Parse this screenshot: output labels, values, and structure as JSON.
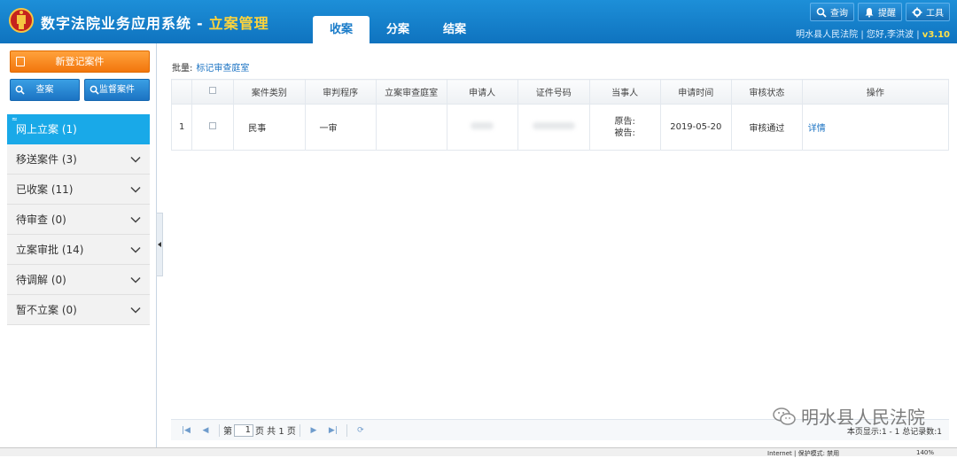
{
  "header": {
    "app_name": "数字法院业务应用系统",
    "separator": "-",
    "module": "立案管理",
    "tabs": [
      {
        "label": "收案",
        "active": true
      },
      {
        "label": "分案",
        "active": false
      },
      {
        "label": "结案",
        "active": false
      }
    ],
    "tools": [
      {
        "label": "查询",
        "icon": "search-icon"
      },
      {
        "label": "提醒",
        "icon": "bell-icon"
      },
      {
        "label": "工具",
        "icon": "gear-icon"
      }
    ],
    "user_info": "明水县人民法院 | 您好,李洪波 |",
    "version": "v3.10"
  },
  "sidebar": {
    "new_case_label": "新登记案件",
    "search_label": "查案",
    "supervise_label": "监督案件",
    "corner_mark": "≈",
    "items": [
      {
        "label": "网上立案 (1)",
        "active": true
      },
      {
        "label": "移送案件 (3)",
        "active": false
      },
      {
        "label": "已收案 (11)",
        "active": false
      },
      {
        "label": "待审查 (0)",
        "active": false
      },
      {
        "label": "立案审批 (14)",
        "active": false
      },
      {
        "label": "待调解 (0)",
        "active": false
      },
      {
        "label": "暂不立案 (0)",
        "active": false
      }
    ]
  },
  "main": {
    "batch_label": "批量:",
    "batch_link": "标记审查庭室",
    "columns": [
      "",
      "",
      "案件类别",
      "审判程序",
      "立案审查庭室",
      "申请人",
      "证件号码",
      "当事人",
      "申请时间",
      "审核状态",
      "操作"
    ],
    "rows": [
      {
        "index": "1",
        "category": "民事",
        "procedure": "一审",
        "review_court": "",
        "applicant": "",
        "id_number": "",
        "party_plaintiff": "原告:",
        "party_defendant": "被告:",
        "apply_time": "2019-05-20",
        "status": "审核通过",
        "action": "详情"
      }
    ],
    "pager": {
      "page_prefix": "第",
      "page_value": "1",
      "page_suffix": "页 共 1 页",
      "info": "本页显示:1 - 1 总记录数:1"
    }
  },
  "watermark": "明水县人民法院",
  "statusbar": {
    "zone": "Internet | 保护模式: 禁用",
    "zoom": "140%"
  },
  "colors": {
    "header_blue": "#1583cf",
    "accent_orange": "#f2760d",
    "active_nav": "#19a9e8",
    "module_yellow": "#ffd43a"
  }
}
